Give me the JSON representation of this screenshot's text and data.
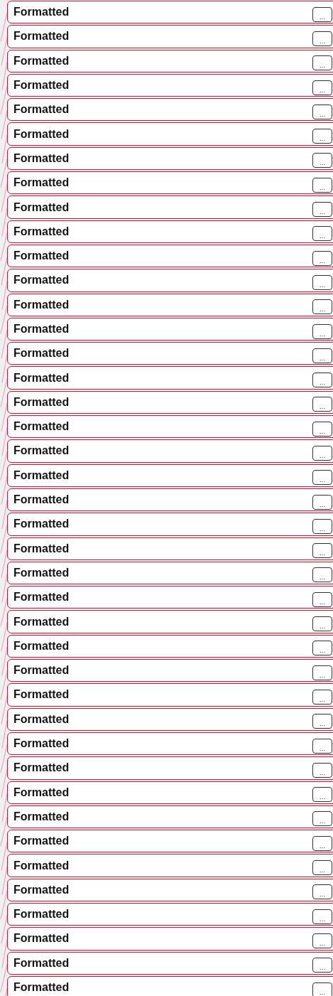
{
  "rows": [
    {
      "label": "Formatted",
      "button": "..."
    },
    {
      "label": "Formatted",
      "button": "..."
    },
    {
      "label": "Formatted",
      "button": "..."
    },
    {
      "label": "Formatted",
      "button": "..."
    },
    {
      "label": "Formatted",
      "button": "..."
    },
    {
      "label": "Formatted",
      "button": "..."
    },
    {
      "label": "Formatted",
      "button": "..."
    },
    {
      "label": "Formatted",
      "button": "..."
    },
    {
      "label": "Formatted",
      "button": "..."
    },
    {
      "label": "Formatted",
      "button": "..."
    },
    {
      "label": "Formatted",
      "button": "..."
    },
    {
      "label": "Formatted",
      "button": "..."
    },
    {
      "label": "Formatted",
      "button": "..."
    },
    {
      "label": "Formatted",
      "button": "..."
    },
    {
      "label": "Formatted",
      "button": "..."
    },
    {
      "label": "Formatted",
      "button": "..."
    },
    {
      "label": "Formatted",
      "button": "..."
    },
    {
      "label": "Formatted",
      "button": "..."
    },
    {
      "label": "Formatted",
      "button": "..."
    },
    {
      "label": "Formatted",
      "button": "..."
    },
    {
      "label": "Formatted",
      "button": "..."
    },
    {
      "label": "Formatted",
      "button": "..."
    },
    {
      "label": "Formatted",
      "button": "..."
    },
    {
      "label": "Formatted",
      "button": "..."
    },
    {
      "label": "Formatted",
      "button": "..."
    },
    {
      "label": "Formatted",
      "button": "..."
    },
    {
      "label": "Formatted",
      "button": "..."
    },
    {
      "label": "Formatted",
      "button": "..."
    },
    {
      "label": "Formatted",
      "button": "..."
    },
    {
      "label": "Formatted",
      "button": "..."
    },
    {
      "label": "Formatted",
      "button": "..."
    },
    {
      "label": "Formatted",
      "button": "..."
    },
    {
      "label": "Formatted",
      "button": "..."
    },
    {
      "label": "Formatted",
      "button": "..."
    },
    {
      "label": "Formatted",
      "button": "..."
    },
    {
      "label": "Formatted",
      "button": "..."
    },
    {
      "label": "Formatted",
      "button": "..."
    },
    {
      "label": "Formatted",
      "button": "..."
    },
    {
      "label": "Formatted",
      "button": "..."
    },
    {
      "label": "Formatted",
      "button": "..."
    },
    {
      "label": "Formatted",
      "button": "..."
    }
  ]
}
